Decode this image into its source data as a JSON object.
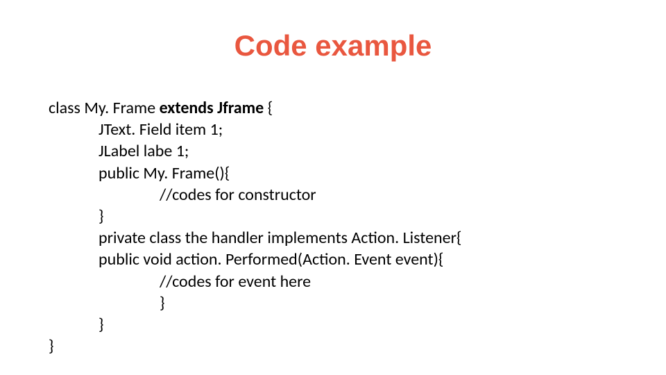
{
  "title": "Code example",
  "code": {
    "l1a": "class My. Frame ",
    "l1b": "extends Jframe",
    "l1c": " {",
    "l2": "JText. Field item 1;",
    "l3": "JLabel labe 1;",
    "l4": "public My. Frame(){",
    "l5": "//codes for constructor",
    "l6": "}",
    "l7": "private class the handler implements Action. Listener{",
    "l8": "public void action. Performed(Action. Event event){",
    "l9": "//codes for event here",
    "l10": "}",
    "l11": "}",
    "l12": "}"
  }
}
